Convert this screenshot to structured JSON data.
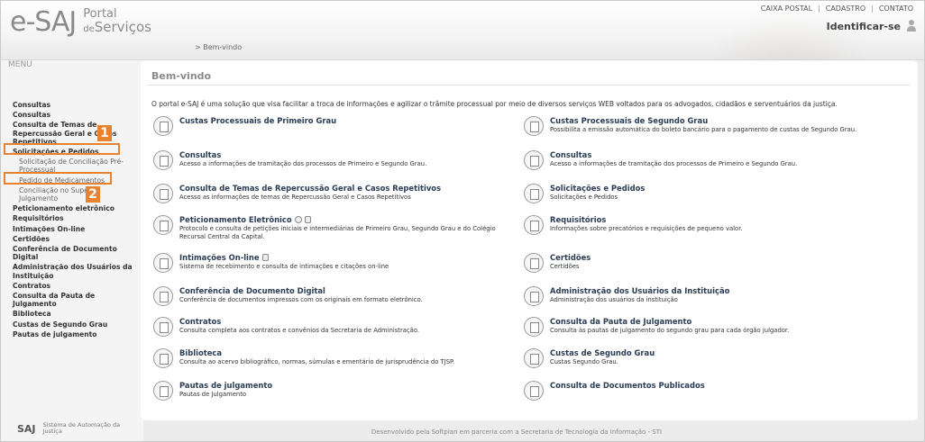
{
  "header": {
    "logo_esaj": "e-SAJ",
    "logo_portal": "Portal",
    "logo_de": "de",
    "logo_servicos": "Serviços",
    "top_links": [
      "CAIXA POSTAL",
      "CADASTRO",
      "CONTATO"
    ],
    "top_sep": "|",
    "identificar": "Identificar-se",
    "breadcrumb": "> Bem-vindo"
  },
  "sidebar": {
    "title": "MENU",
    "items": [
      {
        "label": "Consultas",
        "sub": false
      },
      {
        "label": "Consultas",
        "sub": false
      },
      {
        "label": "Consulta de Temas de Repercussão Geral e Casos Repetitivos",
        "sub": false
      },
      {
        "label": "Solicitações e Pedidos",
        "sub": false
      },
      {
        "label": "Solicitação de Conciliação Pré-Processual",
        "sub": true
      },
      {
        "label": "Pedido de Medicamentos",
        "sub": true
      },
      {
        "label": "Conciliação no Superior Julgamento",
        "sub": true
      },
      {
        "label": "Peticionamento eletrônico",
        "sub": false
      },
      {
        "label": "Requisitórios",
        "sub": false
      },
      {
        "label": "Intimações On-line",
        "sub": false
      },
      {
        "label": "Certidões",
        "sub": false
      },
      {
        "label": "Conferência de Documento Digital",
        "sub": false
      },
      {
        "label": "Administração dos Usuários da Instituição",
        "sub": false
      },
      {
        "label": "Contratos",
        "sub": false
      },
      {
        "label": "Consulta da Pauta de Julgamento",
        "sub": false
      },
      {
        "label": "Biblioteca",
        "sub": false
      },
      {
        "label": "Custas de Segundo Grau",
        "sub": false
      },
      {
        "label": "Pautas de julgamento",
        "sub": false
      }
    ],
    "annotations": [
      "1",
      "2"
    ],
    "footer_saj": "SAJ",
    "footer_desc": "Sistema de Automação da Justiça"
  },
  "main": {
    "title": "Bem-vindo",
    "intro": "O portal e-SAJ é uma solução que visa facilitar a troca de informações e agilizar o trâmite processual por meio de diversos serviços WEB voltados para os advogados, cidadãos e serventuários da justiça.",
    "left_services": [
      {
        "name": "Custas Processuais de Primeiro Grau",
        "desc": ""
      },
      {
        "name": "Consultas",
        "desc": "Acesso a informações de tramitação dos processos de Primeiro e Segundo Grau."
      },
      {
        "name": "Consulta de Temas de Repercussão Geral e Casos Repetitivos",
        "desc": "Acesso as informações de temas de Repercussão Geral e Casos Repetitivos"
      },
      {
        "name": "Peticionamento Eletrônico",
        "desc": "Protocolo e consulta de petições iniciais e intermediárias de Primeiro Grau, Segundo Grau e do Colégio Recursal Central da Capital."
      },
      {
        "name": "Intimações On-line",
        "desc": "Sistema de recebimento e consulta de intimações e citações on-line"
      },
      {
        "name": "Conferência de Documento Digital",
        "desc": "Conferência de documentos impressos com os originais em formato eletrônico."
      },
      {
        "name": "Contratos",
        "desc": "Consulta completa aos contratos e convênios da Secretaria de Administração."
      },
      {
        "name": "Biblioteca",
        "desc": "Consulta ao acervo bibliográfico, normas, súmulas e ementário de jurisprudência do TJSP."
      },
      {
        "name": "Pautas de julgamento",
        "desc": "Pautas de Julgamento"
      }
    ],
    "right_services": [
      {
        "name": "Custas Processuais de Segundo Grau",
        "desc": "Possibilita a emissão automática do boleto bancário para o pagamento de custas de Segundo Grau."
      },
      {
        "name": "Consultas",
        "desc": "Acesso a informações de tramitação dos processos de Primeiro e Segundo Grau."
      },
      {
        "name": "Solicitações e Pedidos",
        "desc": "Solicitações e Pedidos"
      },
      {
        "name": "Requisitórios",
        "desc": "Informações sobre precatórios e requisições de pequeno valor."
      },
      {
        "name": "Certidões",
        "desc": "Certidões"
      },
      {
        "name": "Administração dos Usuários da Instituição",
        "desc": "Administração dos usuários da instituição"
      },
      {
        "name": "Consulta da Pauta de Julgamento",
        "desc": "Consulta às pautas de julgamento do segundo grau para cada órgão julgador."
      },
      {
        "name": "Custas de Segundo Grau",
        "desc": "Custas Segundo Grau."
      },
      {
        "name": "Consulta de Documentos Publicados",
        "desc": ""
      }
    ]
  },
  "footer": {
    "text": "Desenvolvido pela Softplan em parceria com a Secretaria de Tecnologia da Informação - STI"
  },
  "colors": {
    "accent_orange": "#e8822e",
    "link_blue": "#2a3d55"
  }
}
